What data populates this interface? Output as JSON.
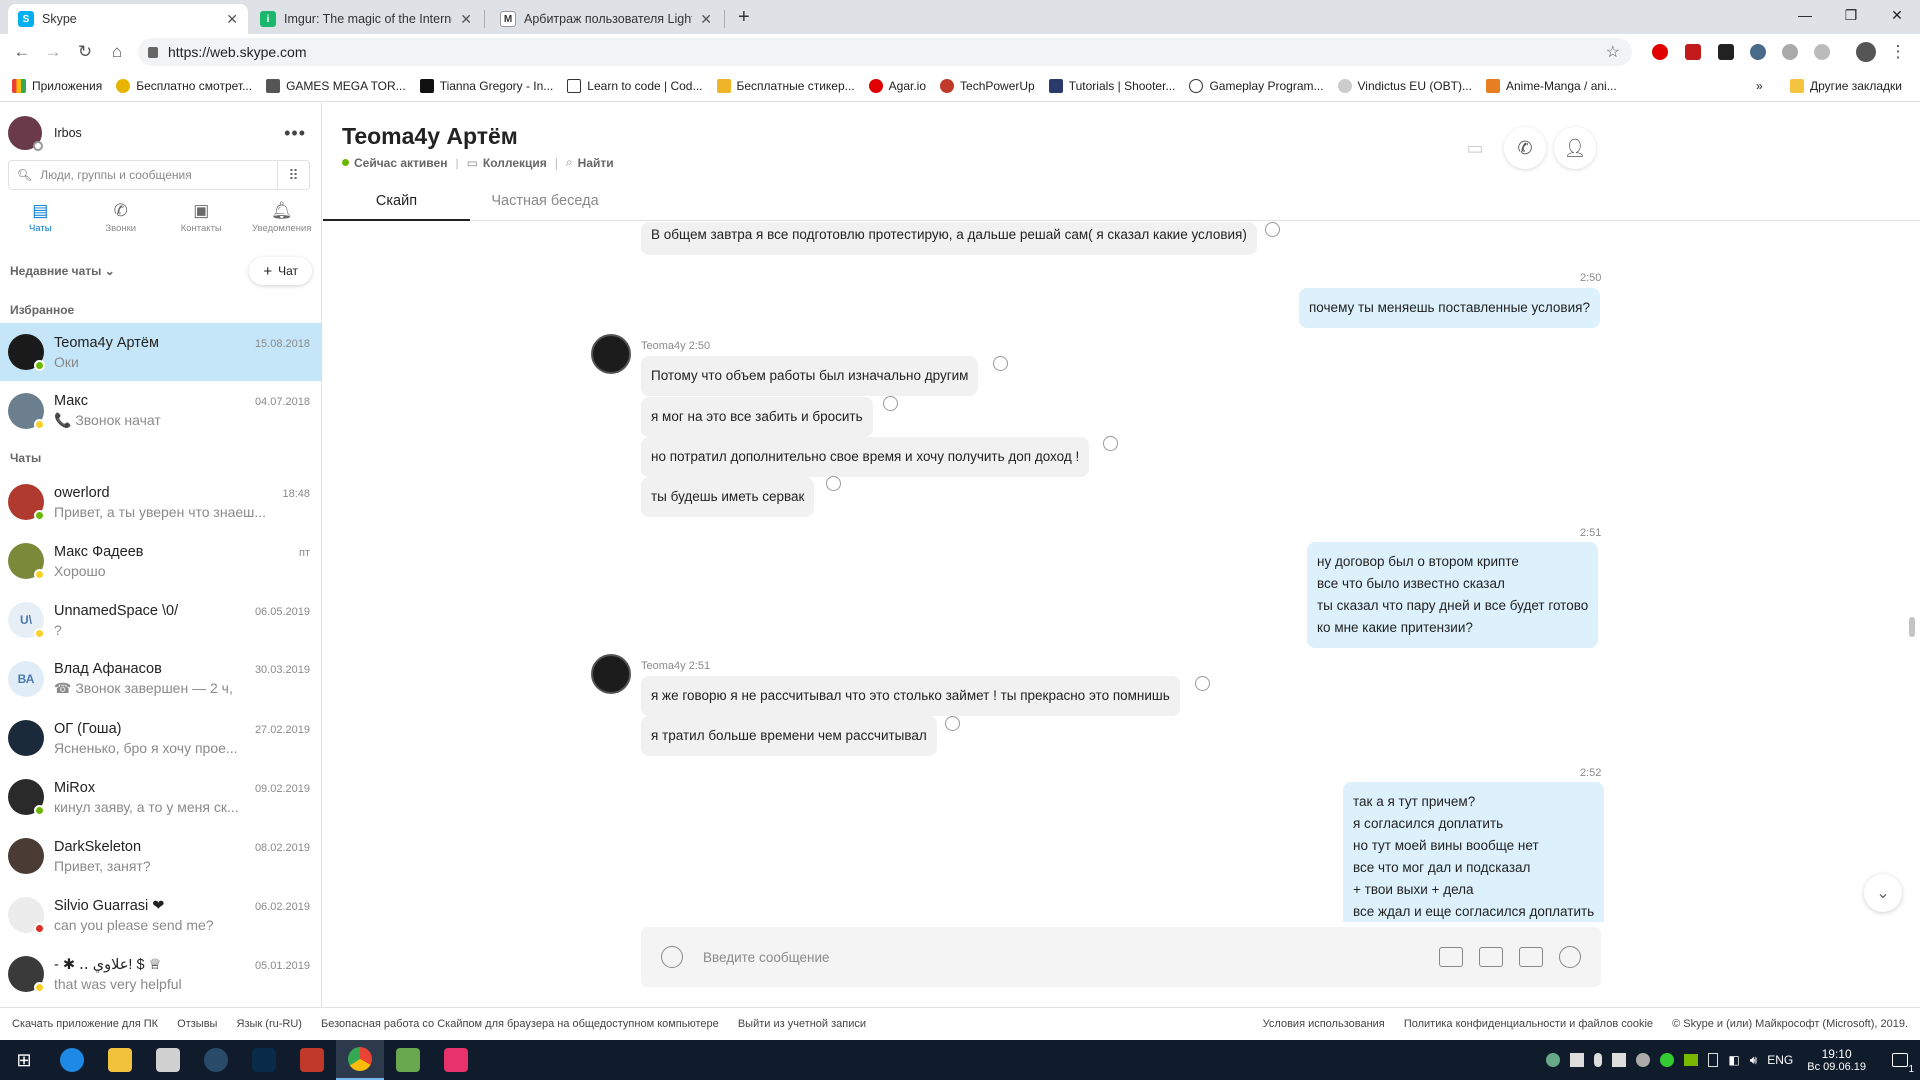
{
  "browser": {
    "tabs": [
      {
        "label": "Skype",
        "active": true
      },
      {
        "label": "Imgur: The magic of the Internet",
        "active": false
      },
      {
        "label": "Арбитраж пользователя LightF",
        "active": false
      }
    ],
    "url": "https://web.skype.com",
    "bookmarks": [
      "Приложения",
      "Бесплатно смотрет...",
      "GAMES MEGA TOR...",
      "Tianna Gregory - In...",
      "Learn to code | Cod...",
      "Бесплатные стикер...",
      "Agar.io",
      "TechPowerUp",
      "Tutorials | Shooter...",
      "Gameplay Program...",
      "Vindictus EU (OBT)...",
      "Anime-Manga / ani..."
    ],
    "other_bookmarks": "Другие закладки"
  },
  "sidebar": {
    "profile_name": "Irbos",
    "search_placeholder": "Люди, группы и сообщения",
    "nav": [
      {
        "label": "Чаты",
        "icon": "chat-icon",
        "active": true
      },
      {
        "label": "Звонки",
        "icon": "phone-icon",
        "active": false
      },
      {
        "label": "Контакты",
        "icon": "contacts-icon",
        "active": false
      },
      {
        "label": "Уведомления",
        "icon": "bell-icon",
        "active": false
      }
    ],
    "recent_label": "Недавние чаты",
    "new_chat_label": "Чат",
    "favorites_header": "Избранное",
    "chats_header": "Чаты",
    "favorites": [
      {
        "name": "Teoma4y Артём",
        "date": "15.08.2018",
        "preview": "Оки",
        "status": "#6bb700",
        "selected": true,
        "avatar_color": "#1a1a1a"
      },
      {
        "name": "Макс",
        "date": "04.07.2018",
        "preview": "📞 Звонок начат",
        "status": "#f8d22a",
        "selected": false,
        "avatar_color": "#6b7f8e"
      }
    ],
    "chats": [
      {
        "name": "owerlord",
        "date": "18:48",
        "preview": "Привет, а ты уверен что знаеш...",
        "status": "#6bb700",
        "avatar_color": "#b03a2e",
        "initials": ""
      },
      {
        "name": "Макс Фадеев",
        "date": "пт",
        "preview": "Хорошо",
        "status": "#f8d22a",
        "avatar_color": "#7a8a3a",
        "initials": ""
      },
      {
        "name": "UnnamedSpace \\0/",
        "date": "06.05.2019",
        "preview": "?",
        "status": "#f8d22a",
        "avatar_color": "#e6eef6",
        "initials": "U\\"
      },
      {
        "name": "Влад Афанасов",
        "date": "30.03.2019",
        "preview": "☎ Звонок завершен — 2 ч,",
        "status": "",
        "avatar_color": "#e0ecf6",
        "initials": "ВА"
      },
      {
        "name": "ОГ (Гоша)",
        "date": "27.02.2019",
        "preview": "Ясненько, бро я хочу прое...",
        "status": "",
        "avatar_color": "#1b2a3a",
        "initials": ""
      },
      {
        "name": "MiRox",
        "date": "09.02.2019",
        "preview": "кинул заяву, а то у меня ск...",
        "status": "#6bb700",
        "avatar_color": "#2a2a2a",
        "initials": ""
      },
      {
        "name": "DarkSkeleton",
        "date": "08.02.2019",
        "preview": "Привет, занят?",
        "status": "",
        "avatar_color": "#4a3b35",
        "initials": ""
      },
      {
        "name": "Silvio Guarrasi ❤",
        "date": "06.02.2019",
        "preview": "can you please send me?",
        "status": "#d93025",
        "avatar_color": "#ececec",
        "initials": ""
      },
      {
        "name": "- ✱ ‥ علاوي! $ ♕",
        "date": "05.01.2019",
        "preview": "that was very helpful",
        "status": "#f8d22a",
        "avatar_color": "#3a3a3a",
        "initials": ""
      }
    ]
  },
  "chat": {
    "title": "Teoma4y Артём",
    "status_text": "Сейчас активен",
    "collection_label": "Коллекция",
    "find_label": "Найти",
    "tabs": [
      "Скайп",
      "Частная беседа"
    ],
    "composer_placeholder": "Введите сообщение",
    "timestamps": {
      "t1": "2:50",
      "t2": "2:51",
      "t3": "2:52"
    },
    "sender_labels": {
      "s1": "Teoma4y 2:50",
      "s2": "Teoma4y 2:51"
    },
    "messages": {
      "m0": "В общем завтра я все подготовлю протестирую, а дальше решай сам( я сказал какие условия)",
      "m1": "почему ты меняешь поставленные условия?",
      "m2": "Потому что объем работы был изначально другим",
      "m3": "я мог на это все забить и бросить",
      "m4": "но потратил дополнительно свое время и хочу получить доп доход !",
      "m5": "ты будешь иметь сервак",
      "m6": [
        "ну договор был о втором крипте",
        "все что было известно сказал",
        "ты сказал что пару дней и все будет готово",
        "ко мне какие притензии?"
      ],
      "m7": "я же говорю я не рассчитывал что это столько займет ! ты прекрасно это помнишь",
      "m8": "я тратил больше времени чем рассчитывал",
      "m9": [
        "так а я тут причем?",
        "я согласился доплатить",
        "но тут моей вины вообще нет",
        "все что мог дал и подсказал",
        "+ твои выхи + дела",
        "все ждал и еще согласился доплатить"
      ]
    }
  },
  "footer": {
    "left": [
      "Скачать приложение для ПК",
      "Отзывы",
      "Язык (ru-RU)",
      "Безопасная работа со Скайпом для браузера на общедоступном компьютере",
      "Выйти из учетной записи"
    ],
    "right": [
      "Условия использования",
      "Политика конфиденциальности и файлов cookie",
      "© Skype и (или) Майкрософт (Microsoft), 2019."
    ]
  },
  "taskbar": {
    "lang": "ENG",
    "time": "19:10",
    "date": "Вс 09.06.19",
    "notif_count": "1"
  }
}
